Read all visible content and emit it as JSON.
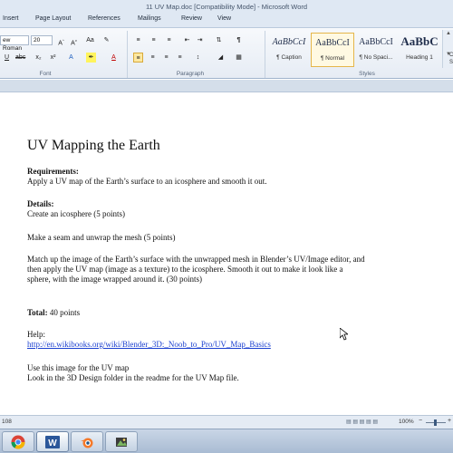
{
  "window": {
    "title": "11 UV Map.doc [Compatibility Mode]  -  Microsoft Word"
  },
  "ribbon_tabs": [
    "Insert",
    "Page Layout",
    "References",
    "Mailings",
    "Review",
    "View"
  ],
  "font_group": {
    "font_name": "ew Roman",
    "font_size": "20",
    "label": "Font"
  },
  "paragraph_group": {
    "label": "Paragraph"
  },
  "styles_group": {
    "label": "Styles",
    "items": [
      {
        "preview": "AaBbCcI",
        "name": "¶ Caption",
        "selected": false
      },
      {
        "preview": "AaBbCcI",
        "name": "¶ Normal",
        "selected": true
      },
      {
        "preview": "AaBbCcI",
        "name": "¶ No Spaci...",
        "selected": false
      },
      {
        "preview": "AaBbC",
        "name": "Heading 1",
        "selected": false
      }
    ],
    "more_label": "C S"
  },
  "document": {
    "title": "UV Mapping the Earth",
    "requirements_label": "Requirements:",
    "requirements_text": "Apply a UV map of the Earth’s surface to an icosphere and smooth it out.",
    "details_label": "Details:",
    "detail_1": "Create an icosphere (5 points)",
    "detail_2": "Make a seam and unwrap the mesh (5 points)",
    "detail_3_line1": "Match up the image  of the Earth’s surface with the unwrapped mesh in Blender’s UV/Image editor, and",
    "detail_3_line2": "then apply the UV map (image as a texture) to the icosphere. Smooth it out to make it look like a",
    "detail_3_line3": "sphere, with the image wrapped around it. (30 points)",
    "total_label": "Total:",
    "total_text": " 40 points",
    "help_label": "Help:",
    "help_link": "http://en.wikibooks.org/wiki/Blender_3D:_Noob_to_Pro/UV_Map_Basics",
    "use_line1": "Use this image for the UV map",
    "use_line2": "Look in the 3D Design folder in the readme for the UV Map file."
  },
  "statusbar": {
    "words": "108",
    "zoom": "100%"
  },
  "taskbar": {
    "apps": [
      "chrome-icon",
      "word-icon",
      "blender-icon",
      "media-icon"
    ]
  },
  "colors": {
    "link": "#1a3fd0",
    "ribbon": "#dfe8f3",
    "selected_style": "#e5b64a"
  }
}
